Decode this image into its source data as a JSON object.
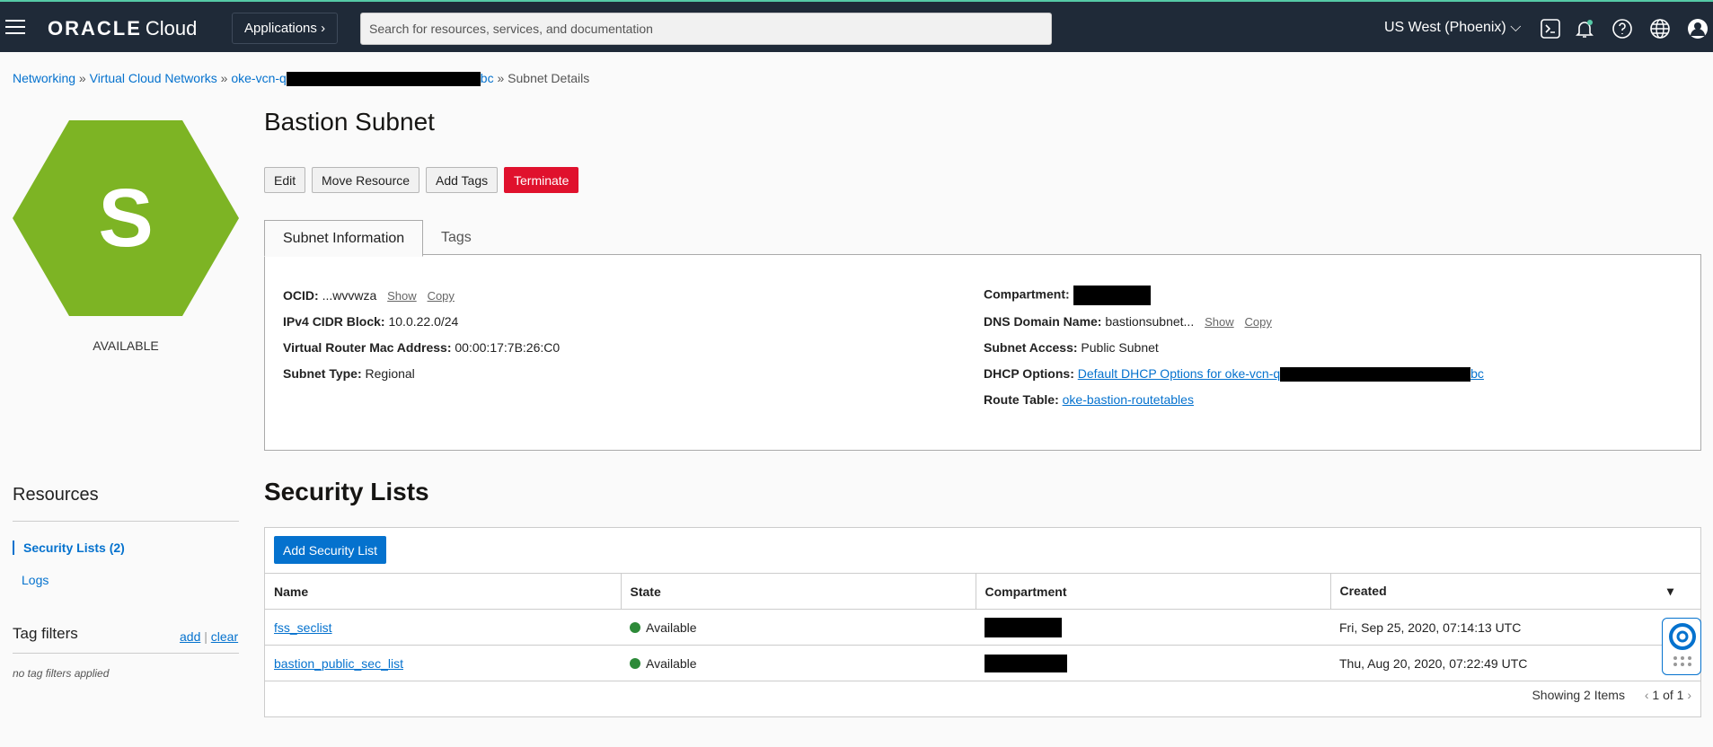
{
  "topbar": {
    "brand": "ORACLE",
    "brand_suffix": "Cloud",
    "applications_label": "Applications",
    "search_placeholder": "Search for resources, services, and documentation",
    "region": "US West (Phoenix)",
    "icons": [
      "hamburger-icon",
      "cloud-shell-icon",
      "bell-icon",
      "help-icon",
      "globe-icon",
      "user-icon"
    ]
  },
  "breadcrumb": {
    "items": [
      "Networking",
      "Virtual Cloud Networks"
    ],
    "vcn_prefix": "oke-vcn-q",
    "vcn_suffix": "bc",
    "current": "Subnet Details",
    "separator": "»"
  },
  "resource": {
    "letter": "S",
    "status": "AVAILABLE",
    "title": "Bastion Subnet"
  },
  "actions": {
    "edit": "Edit",
    "move": "Move Resource",
    "add_tags": "Add Tags",
    "terminate": "Terminate"
  },
  "tabs": {
    "info": "Subnet Information",
    "tags": "Tags"
  },
  "info_left": {
    "ocid_label": "OCID:",
    "ocid_value": "...wvvwza",
    "show": "Show",
    "copy": "Copy",
    "cidr_label": "IPv4 CIDR Block:",
    "cidr_value": "10.0.22.0/24",
    "mac_label": "Virtual Router Mac Address:",
    "mac_value": "00:00:17:7B:26:C0",
    "type_label": "Subnet Type:",
    "type_value": "Regional"
  },
  "info_right": {
    "compartment_label": "Compartment:",
    "dns_label": "DNS Domain Name:",
    "dns_value": "bastionsubnet...",
    "show": "Show",
    "copy": "Copy",
    "access_label": "Subnet Access:",
    "access_value": "Public Subnet",
    "dhcp_label": "DHCP Options:",
    "dhcp_prefix": "Default DHCP Options for oke-vcn-q",
    "dhcp_suffix": "bc",
    "route_label": "Route Table:",
    "route_value": "oke-bastion-routetables"
  },
  "sidebar": {
    "resources_heading": "Resources",
    "items": [
      {
        "label": "Security Lists (2)",
        "active": true
      },
      {
        "label": "Logs",
        "active": false
      }
    ],
    "tag_filters_heading": "Tag filters",
    "add": "add",
    "clear": "clear",
    "no_filters": "no tag filters applied"
  },
  "security_lists": {
    "title": "Security Lists",
    "add_button": "Add Security List",
    "columns": [
      "Name",
      "State",
      "Compartment",
      "Created"
    ],
    "rows": [
      {
        "name": "fss_seclist",
        "state": "Available",
        "created": "Fri, Sep 25, 2020, 07:14:13 UTC"
      },
      {
        "name": "bastion_public_sec_list",
        "state": "Available",
        "created": "Thu, Aug 20, 2020, 07:22:49 UTC"
      }
    ],
    "showing": "Showing 2 Items",
    "page": "1 of 1"
  },
  "colors": {
    "topbar": "#1f2a38",
    "accent": "#0572ce",
    "hexagon": "#7db424",
    "danger": "#e0112d",
    "available": "#2d8a39"
  }
}
